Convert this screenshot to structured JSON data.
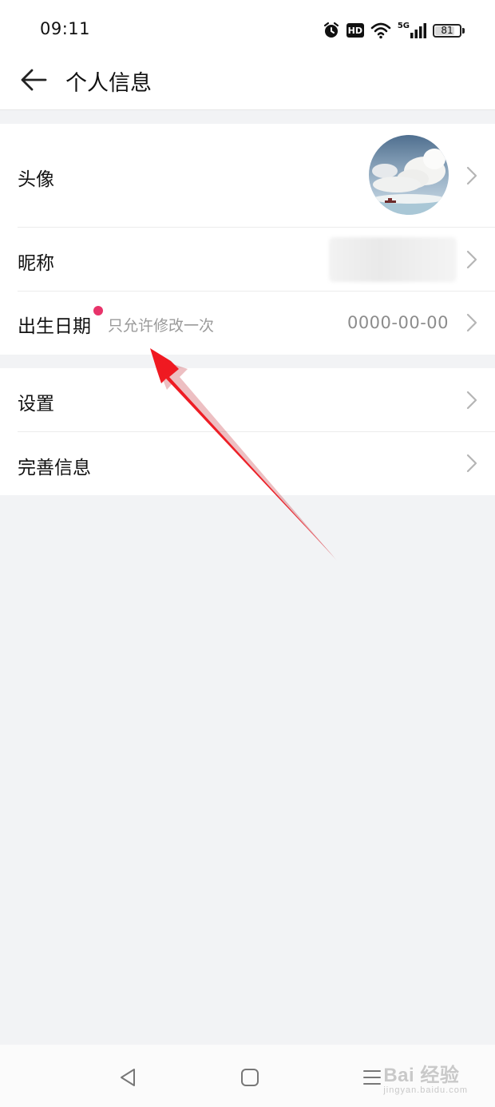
{
  "status_bar": {
    "time": "09:11",
    "icons": [
      "alarm-icon",
      "hd-icon",
      "wifi-icon",
      "5g-signal-icon",
      "battery-icon"
    ],
    "hd_label": "HD",
    "network_label": "5G",
    "battery_level": "81"
  },
  "header": {
    "title": "个人信息",
    "back_icon": "back-arrow-icon"
  },
  "group1": {
    "rows": [
      {
        "label": "头像"
      },
      {
        "label": "昵称"
      },
      {
        "label": "出生日期",
        "hint": "只允许修改一次",
        "value": "0000-00-00"
      }
    ]
  },
  "group2": {
    "rows": [
      {
        "label": "设置"
      },
      {
        "label": "完善信息"
      }
    ]
  },
  "nav_bar": {
    "icons": [
      "nav-back-icon",
      "nav-home-icon",
      "nav-menu-icon"
    ]
  },
  "watermark": {
    "main": "Bai 经验",
    "sub": "jingyan.baidu.com"
  },
  "colors": {
    "accent_dot": "#e8336a",
    "annotation_arrow": "#e8141c",
    "background": "#f2f3f5"
  }
}
